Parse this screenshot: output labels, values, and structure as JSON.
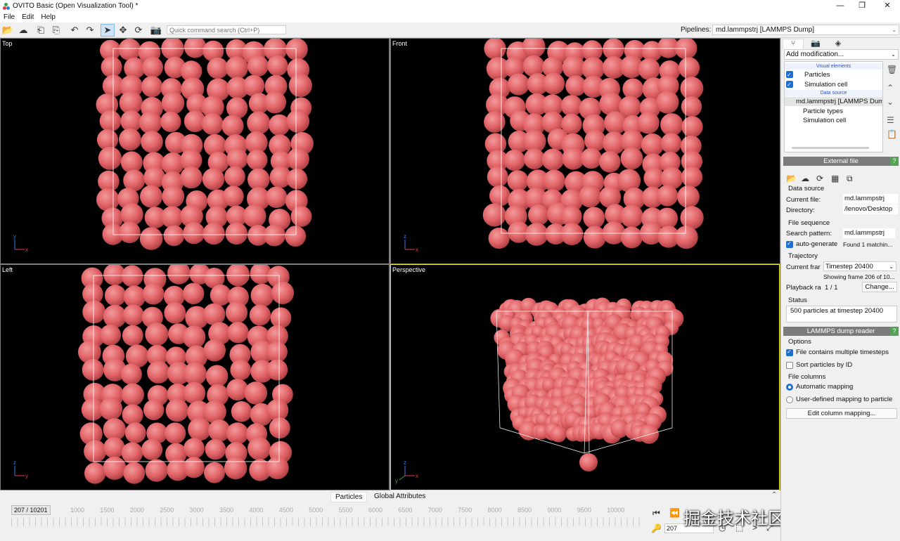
{
  "window": {
    "title": "OVITO Basic (Open Visualization Tool) *"
  },
  "menu": [
    "File",
    "Edit",
    "Help"
  ],
  "toolbar": {
    "command_placeholder": "Quick command search (Ctrl+P)",
    "pipelines_label": "Pipelines:",
    "pipeline_value": "md.lammpstrj [LAMMPS Dump]"
  },
  "viewports": [
    {
      "name": "Top",
      "axes": [
        "y",
        "x"
      ]
    },
    {
      "name": "Front",
      "axes": [
        "z",
        "x"
      ]
    },
    {
      "name": "Left",
      "axes": [
        "z",
        "y"
      ]
    },
    {
      "name": "Perspective",
      "axes": [
        "z",
        "x",
        "y"
      ]
    }
  ],
  "colors": {
    "particle": "#e26468",
    "particle_highlight": "#f29a9c",
    "viewport_bg": "#000000",
    "active_border": "#ecec2a",
    "section_header": "#7b7b7b",
    "help_badge": "#56a157",
    "checkbox": "#1f6fd1"
  },
  "bottom_tabs": [
    "Particles",
    "Global Attributes"
  ],
  "timeline": {
    "frame_display": "207 / 10201",
    "ticks": [
      "1000",
      "1500",
      "2000",
      "2500",
      "3000",
      "3500",
      "4000",
      "4500",
      "5000",
      "5500",
      "6000",
      "6500",
      "7000",
      "7500",
      "8000",
      "8500",
      "9000",
      "9500",
      "10000"
    ],
    "current_frame": "207"
  },
  "watermark": "掘金技术社区 @ 神经星星",
  "panel": {
    "add_modification": "Add modification...",
    "visual_elements_header": "Visual elements",
    "visual_elements": [
      "Particles",
      "Simulation cell"
    ],
    "data_source_header": "Data source",
    "data_source_item": "md.lammpstrj [LAMMPS Dump]",
    "sub_items": [
      "Particle types",
      "Simulation cell"
    ],
    "external_file_title": "External file",
    "help": "?",
    "data_source_label": "Data source",
    "current_file_label": "Current file:",
    "current_file_value": "md.lammpstrj",
    "directory_label": "Directory:",
    "directory_value": "/lenovo/Desktop",
    "file_sequence_label": "File sequence",
    "search_pattern_label": "Search pattern:",
    "search_pattern_value": "md.lammpstrj",
    "auto_generate_label": "auto-generate",
    "found_text": "Found 1 matchin...",
    "trajectory_label": "Trajectory",
    "current_frame_label": "Current frar",
    "current_frame_value": "Timestep 20400",
    "showing_frame": "Showing frame 206 of 10...",
    "playback_label": "Playback ra",
    "playback_value": "1 / 1",
    "change_button": "Change...",
    "status_label": "Status",
    "status_value": "500 particles at timestep 20400",
    "reader_title": "LAMMPS dump reader",
    "options_label": "Options",
    "opt_multiple": "File contains multiple timesteps",
    "opt_sort": "Sort particles by ID",
    "file_columns_label": "File columns",
    "auto_mapping": "Automatic mapping",
    "user_mapping": "User-defined mapping to particle",
    "edit_mapping": "Edit column mapping..."
  }
}
